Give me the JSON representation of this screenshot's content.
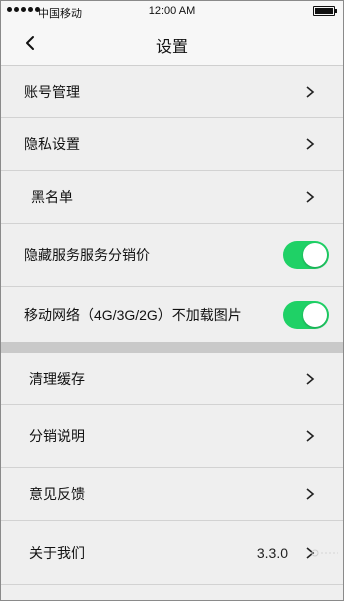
{
  "status_bar": {
    "carrier": "中国移动",
    "time": "12:00 AM"
  },
  "navbar": {
    "title": "设置",
    "back_icon": "chevron-left-icon"
  },
  "colors": {
    "toggle_on": "#1fd166",
    "background": "#efefef",
    "section_divider": "#c9c9c9"
  },
  "settings": {
    "account": {
      "label": "账号管理"
    },
    "privacy": {
      "label": "隐私设置"
    },
    "blacklist": {
      "label": "黑名单"
    },
    "hide_price": {
      "label": "隐藏服务服务分销价",
      "enabled": true
    },
    "no_images_mobile": {
      "label": "移动网络（4G/3G/2G）不加载图片",
      "enabled": true
    },
    "clear_cache": {
      "label": "清理缓存"
    },
    "distribution": {
      "label": "分销说明"
    },
    "feedback": {
      "label": "意见反馈"
    },
    "about": {
      "label": "关于我们",
      "value": "3.3.0"
    }
  }
}
